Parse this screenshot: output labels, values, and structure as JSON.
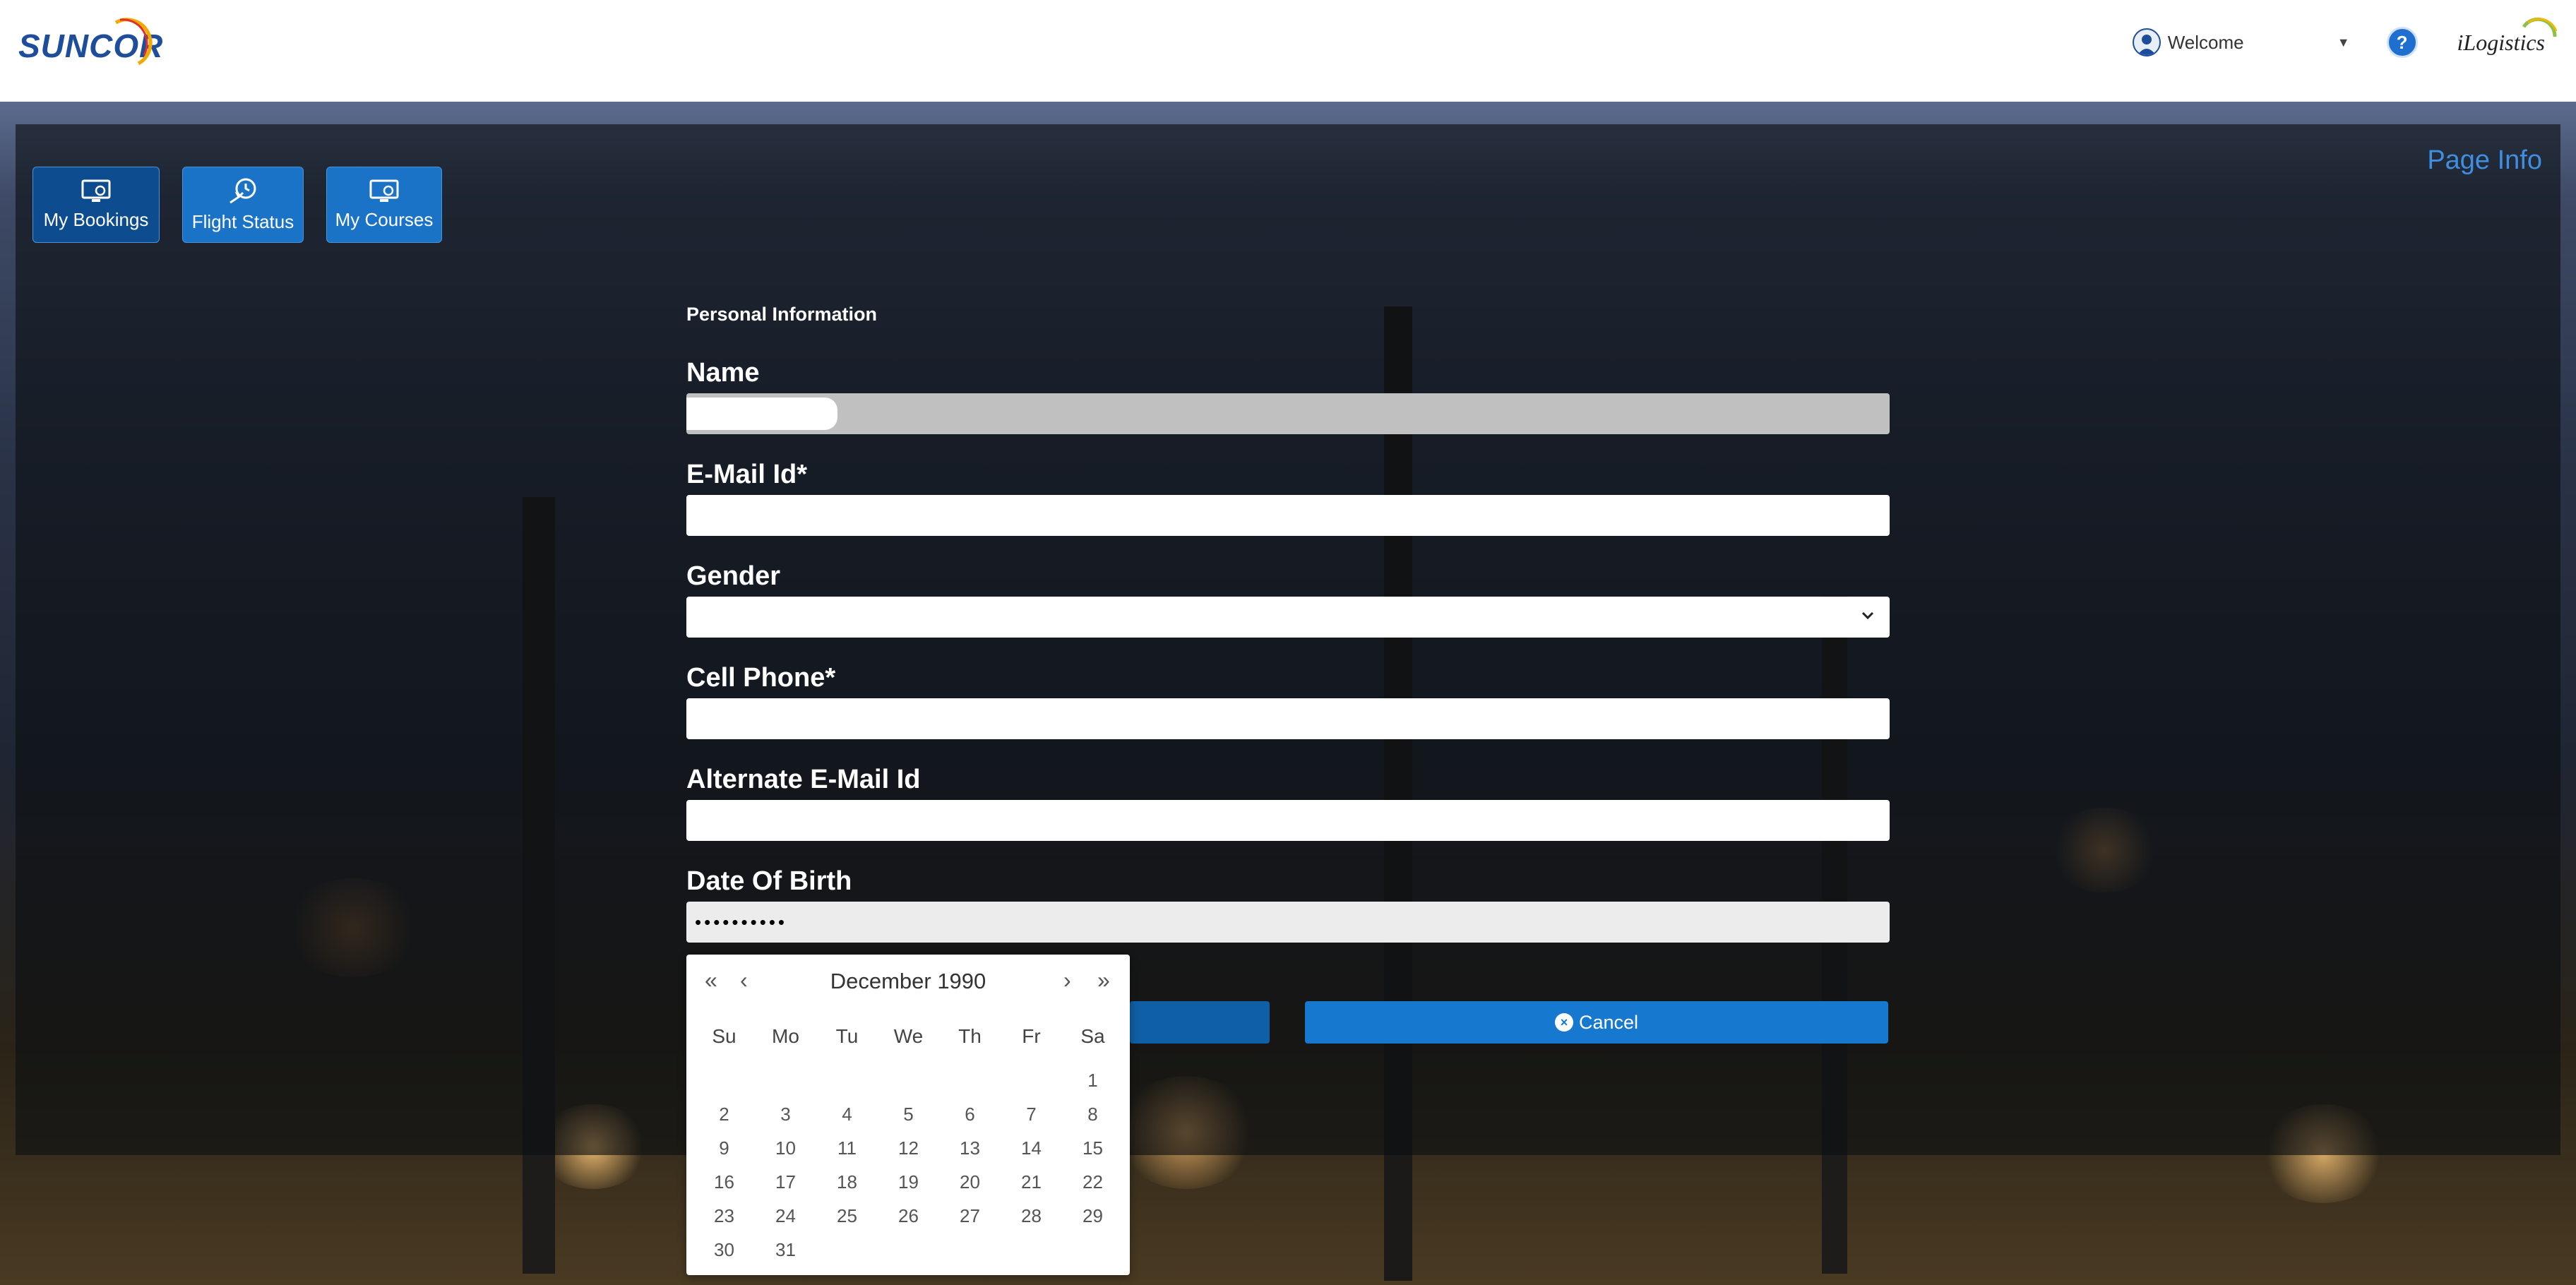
{
  "header": {
    "logo_text": "SUNCOR",
    "welcome": "Welcome",
    "help_glyph": "?",
    "partner_logo_text": "iLogistics"
  },
  "nav": {
    "my_bookings": "My Bookings",
    "flight_status": "Flight Status",
    "my_courses": "My Courses"
  },
  "page_info": "Page Info",
  "form": {
    "section_title": "Personal Information",
    "name_label": "Name",
    "email_label": "E-Mail Id*",
    "gender_label": "Gender",
    "cell_label": "Cell Phone*",
    "alt_email_label": "Alternate E-Mail Id",
    "dob_label": "Date Of Birth",
    "dob_value": "••••••••••"
  },
  "buttons": {
    "cancel": "Cancel"
  },
  "calendar": {
    "month_year": "December 1990",
    "prev_year": "«",
    "prev_month": "‹",
    "next_month": "›",
    "next_year": "»",
    "weekdays": [
      "Su",
      "Mo",
      "Tu",
      "We",
      "Th",
      "Fr",
      "Sa"
    ],
    "weeks": [
      [
        "",
        "",
        "",
        "",
        "",
        "",
        "1"
      ],
      [
        "2",
        "3",
        "4",
        "5",
        "6",
        "7",
        "8"
      ],
      [
        "9",
        "10",
        "11",
        "12",
        "13",
        "14",
        "15"
      ],
      [
        "16",
        "17",
        "18",
        "19",
        "20",
        "21",
        "22"
      ],
      [
        "23",
        "24",
        "25",
        "26",
        "27",
        "28",
        "29"
      ],
      [
        "30",
        "31",
        "",
        "",
        "",
        "",
        ""
      ]
    ]
  },
  "colors": {
    "brand_blue": "#1e4d9c",
    "button_blue": "#1778d0",
    "page_info_blue": "#3f8ee0"
  }
}
